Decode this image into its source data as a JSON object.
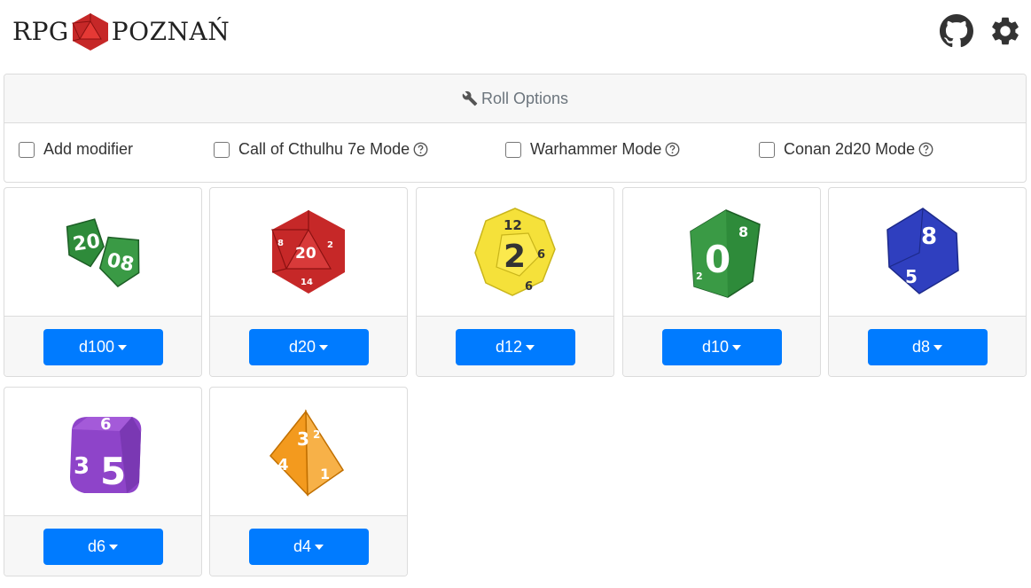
{
  "header": {
    "logo_left": "RPG",
    "logo_right": "POZNAŃ",
    "icons": [
      "d20-logo-icon",
      "github-icon",
      "gear-icon"
    ]
  },
  "options": {
    "title": "Roll Options",
    "title_icon": "wrench-icon",
    "items": [
      {
        "label": "Add modifier",
        "checked": false,
        "help": false
      },
      {
        "label": "Call of Cthulhu 7e Mode",
        "checked": false,
        "help": true
      },
      {
        "label": "Warhammer Mode",
        "checked": false,
        "help": true
      },
      {
        "label": "Conan 2d20 Mode",
        "checked": false,
        "help": true
      }
    ]
  },
  "dice": [
    {
      "label": "d100",
      "icon": "d100-dice-icon",
      "color": "#2e8b3a"
    },
    {
      "label": "d20",
      "icon": "d20-dice-icon",
      "color": "#c62828"
    },
    {
      "label": "d12",
      "icon": "d12-dice-icon",
      "color": "#f5e13a"
    },
    {
      "label": "d10",
      "icon": "d10-dice-icon",
      "color": "#2e8b3a"
    },
    {
      "label": "d8",
      "icon": "d8-dice-icon",
      "color": "#2f3fbf"
    },
    {
      "label": "d6",
      "icon": "d6-dice-icon",
      "color": "#8e44c9"
    },
    {
      "label": "d4",
      "icon": "d4-dice-icon",
      "color": "#f39a1e"
    }
  ],
  "colors": {
    "primary": "#007bff",
    "card_border": "#dcdcdc",
    "card_header": "#f7f7f7"
  }
}
